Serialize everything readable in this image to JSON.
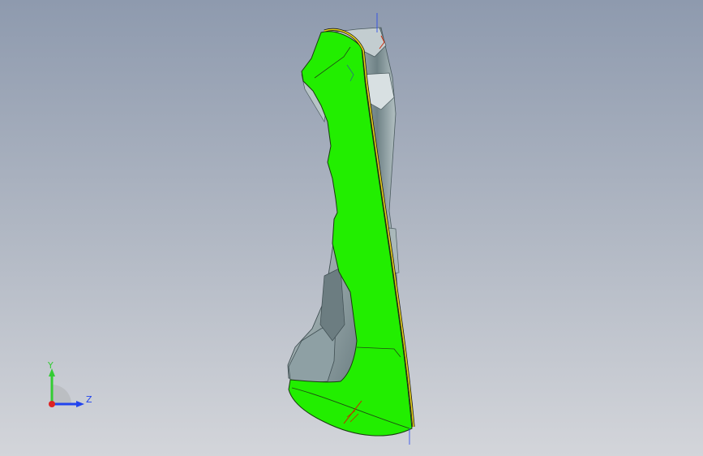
{
  "viewport": {
    "background_top": "#8e9aae",
    "background_bottom": "#d3d5da",
    "selection_color": "#22ee00",
    "model_shade_color": "#7f9296",
    "edge_highlight_color": "#e6d21a",
    "sketch_line_color": "#cc2200"
  },
  "triad": {
    "y_label": "Y",
    "z_label": "Z",
    "y_color": "#33cc33",
    "z_color": "#2244ee",
    "x_color": "#dd2222"
  }
}
